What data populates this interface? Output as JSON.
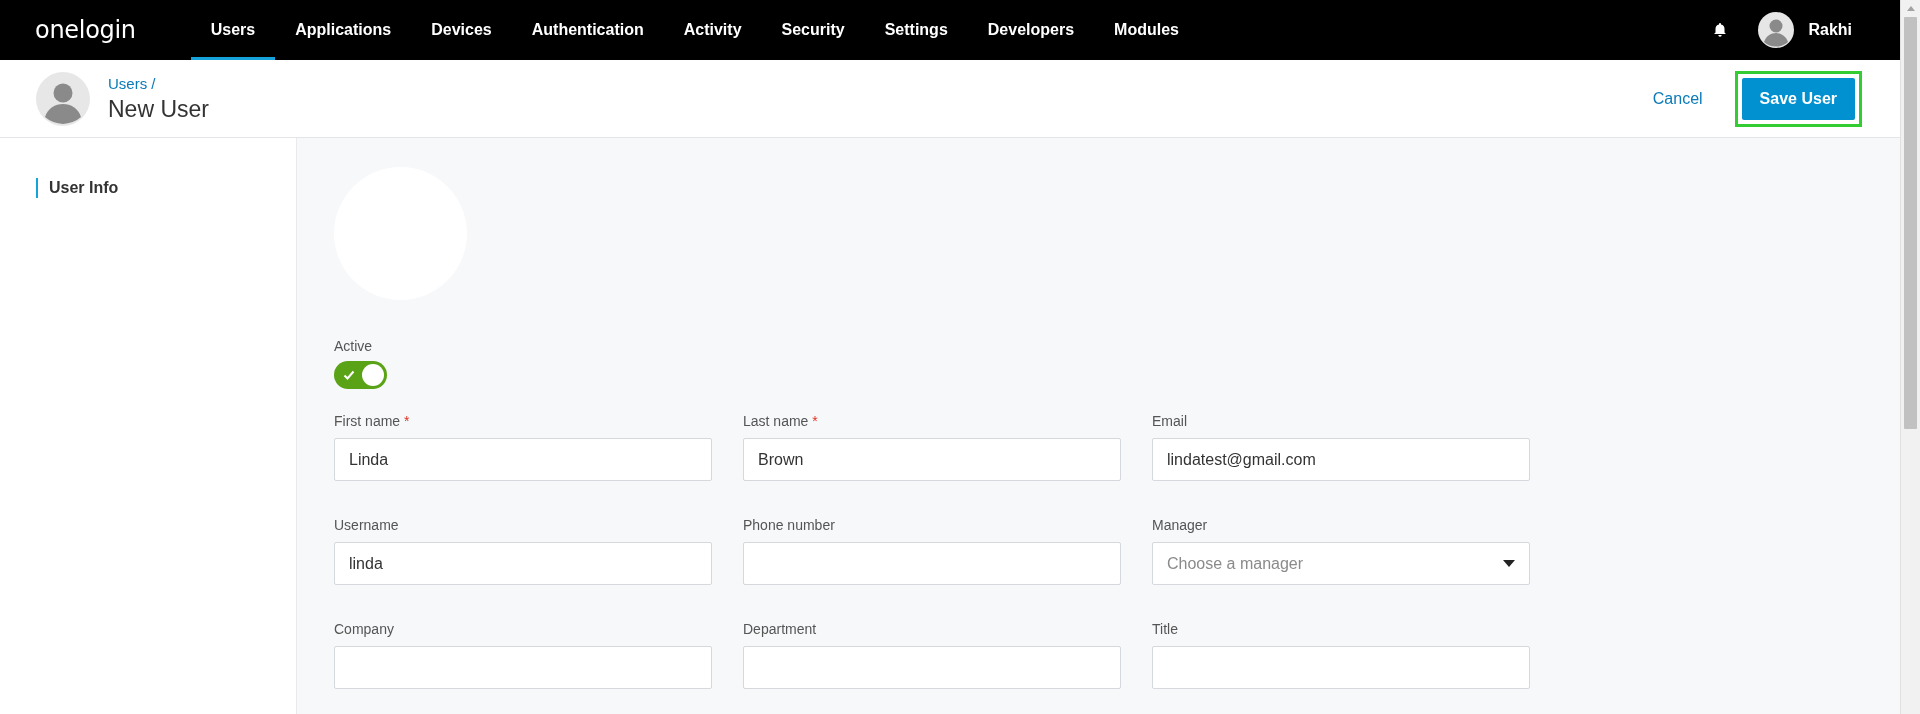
{
  "top_nav": {
    "logo": "onelogin",
    "items": [
      {
        "label": "Users",
        "selected": true
      },
      {
        "label": "Applications",
        "selected": false
      },
      {
        "label": "Devices",
        "selected": false
      },
      {
        "label": "Authentication",
        "selected": false
      },
      {
        "label": "Activity",
        "selected": false
      },
      {
        "label": "Security",
        "selected": false
      },
      {
        "label": "Settings",
        "selected": false
      },
      {
        "label": "Developers",
        "selected": false
      },
      {
        "label": "Modules",
        "selected": false
      }
    ],
    "user_name": "Rakhi"
  },
  "page_header": {
    "breadcrumb": "Users /",
    "title": "New User",
    "cancel": "Cancel",
    "save": "Save User",
    "save_highlighted": true
  },
  "sidebar": {
    "items": [
      {
        "label": "User Info",
        "selected": true
      }
    ]
  },
  "form": {
    "active": {
      "label": "Active",
      "on": true
    },
    "fields": [
      {
        "kind": "text",
        "label": "First name",
        "required_mark": "*",
        "value": "Linda"
      },
      {
        "kind": "text",
        "label": "Last name",
        "required_mark": "*",
        "value": "Brown"
      },
      {
        "kind": "text",
        "label": "Email",
        "value": "lindatest@gmail.com"
      },
      {
        "kind": "text",
        "label": "Username",
        "value": "linda"
      },
      {
        "kind": "text",
        "label": "Phone number"
      },
      {
        "kind": "select",
        "label": "Manager",
        "placeholder": "Choose a manager"
      },
      {
        "kind": "text",
        "label": "Company"
      },
      {
        "kind": "text",
        "label": "Department"
      },
      {
        "kind": "text",
        "label": "Title"
      }
    ]
  }
}
